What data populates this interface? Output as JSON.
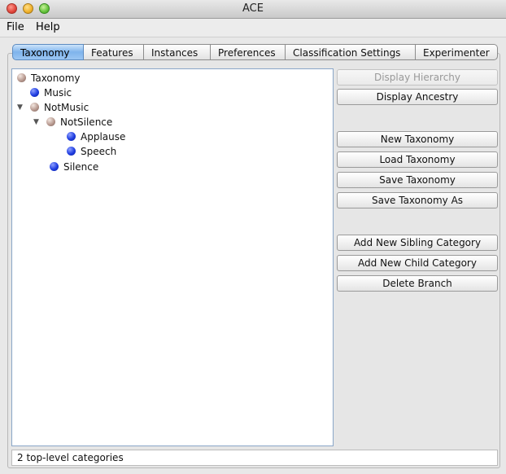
{
  "window": {
    "title": "ACE"
  },
  "menu": [
    "File",
    "Help"
  ],
  "tabs": [
    {
      "label": "Taxonomy",
      "active": true
    },
    {
      "label": "Features",
      "active": false
    },
    {
      "label": "Instances",
      "active": false
    },
    {
      "label": "Preferences",
      "active": false
    },
    {
      "label": "Classification Settings",
      "active": false
    },
    {
      "label": "Experimenter",
      "active": false
    }
  ],
  "tree": [
    {
      "label": "Taxonomy",
      "depth": 0,
      "type": "branch",
      "expanded": null
    },
    {
      "label": "Music",
      "depth": 1,
      "type": "leaf",
      "expanded": null
    },
    {
      "label": "NotMusic",
      "depth": 1,
      "type": "branch",
      "expanded": true
    },
    {
      "label": "NotSilence",
      "depth": 2,
      "type": "branch",
      "expanded": true
    },
    {
      "label": "Applause",
      "depth": 3,
      "type": "leaf",
      "expanded": null
    },
    {
      "label": "Speech",
      "depth": 3,
      "type": "leaf",
      "expanded": null
    },
    {
      "label": "Silence",
      "depth": 2,
      "type": "leaf",
      "expanded": null
    }
  ],
  "buttons": [
    {
      "label": "Display Hierarchy",
      "enabled": false
    },
    {
      "label": "Display Ancestry",
      "enabled": true
    },
    {
      "label": "New Taxonomy",
      "enabled": true
    },
    {
      "label": "Load Taxonomy",
      "enabled": true
    },
    {
      "label": "Save Taxonomy",
      "enabled": true
    },
    {
      "label": "Save Taxonomy As",
      "enabled": true
    },
    {
      "label": "Add New Sibling Category",
      "enabled": true
    },
    {
      "label": "Add New Child Category",
      "enabled": true
    },
    {
      "label": "Delete Branch",
      "enabled": true
    }
  ],
  "status": {
    "text": "2 top-level categories"
  },
  "icons": {
    "leaf": "blue-sphere-icon",
    "branch": "brown-sphere-icon",
    "expanded": "▼"
  },
  "colors": {
    "leaf": "#1f3de0",
    "branch": "#b89a90",
    "active_tab": "#7fb4ec"
  }
}
